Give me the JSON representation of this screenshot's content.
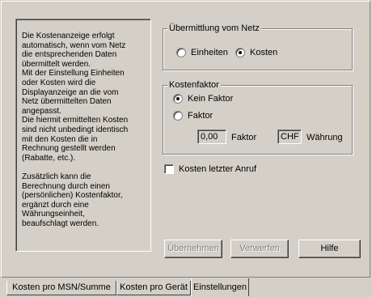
{
  "description_text": "Die Kostenanzeige erfolgt\nautomatisch, wenn vom Netz\ndie entsprechenden Daten\nübermittelt werden.\nMit der Einstellung Einheiten\noder Kosten wird die\nDisplayanzeige an die vom\nNetz übermittelten Daten\nangepasst.\nDie hiermit ermittelten Kosten\nsind nicht unbedingt identisch\nmit den Kosten die in\nRechnung gestellt werden\n(Rabatte, etc.).\n\nZusätzlich kann die\nBerechnung durch einen\n(persönlichen) Kostenfaktor,\nergänzt durch eine\nWährungseinheit,\nbeaufschlagt werden.",
  "transmission": {
    "title": "Übermittlung vom Netz",
    "options": [
      {
        "label": "Einheiten",
        "selected": false
      },
      {
        "label": "Kosten",
        "selected": true
      }
    ]
  },
  "cost_factor": {
    "title": "Kostenfaktor",
    "options": [
      {
        "label": "Kein Faktor",
        "selected": true
      },
      {
        "label": "Faktor",
        "selected": false
      }
    ],
    "factor_value": "0,00",
    "factor_label": "Faktor",
    "currency_value": "CHF",
    "currency_label": "Währung"
  },
  "last_call_checkbox": {
    "label": "Kosten letzter Anruf",
    "checked": false
  },
  "buttons": {
    "apply": "Übernehmen",
    "discard": "Verwerfen",
    "help": "Hilfe"
  },
  "tabs": [
    {
      "label": "Kosten pro MSN/Summe",
      "active": false
    },
    {
      "label": "Kosten pro Gerät",
      "active": false
    },
    {
      "label": "Einstellungen",
      "active": true
    }
  ]
}
